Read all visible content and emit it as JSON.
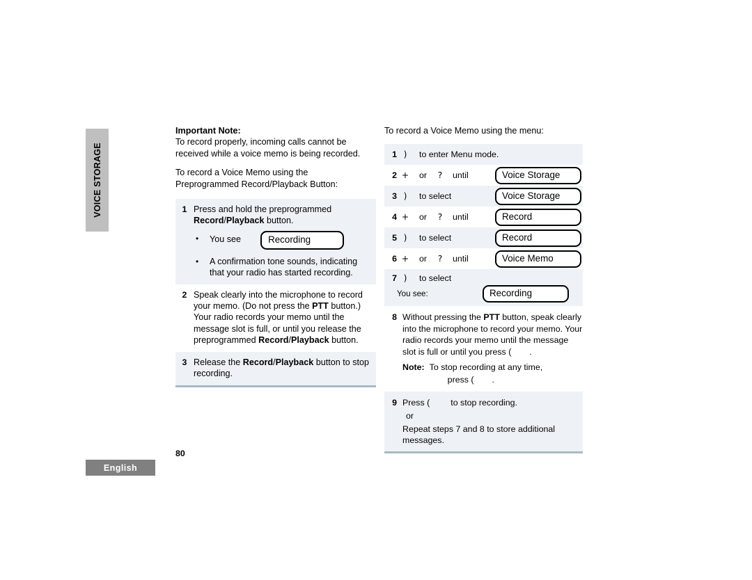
{
  "side_tab": {
    "label": "VOICE STORAGE"
  },
  "footer": {
    "language": "English",
    "page_number": "80"
  },
  "left_column": {
    "important_note_heading": "Important Note:",
    "important_note_body": "To record properly, incoming calls cannot be received while a voice memo is being recorded.",
    "intro_line1": "To record a Voice Memo using the",
    "intro_line2_prefix": "Preprogrammed Record/Playback Button",
    "intro_line2_suffix": ":",
    "steps": [
      {
        "number": "1",
        "text_parts": [
          "Press and hold the preprogrammed ",
          "Record",
          "/",
          "Playback",
          " button."
        ],
        "bullets": [
          {
            "label": "You see",
            "lcd": "Recording"
          },
          {
            "label": "A confirmation tone sounds, indicating that your radio has started recording."
          }
        ]
      },
      {
        "number": "2",
        "text_parts": [
          "Speak clearly into the microphone to record your memo. (Do not press the ",
          "PTT",
          " button.) Your radio records your memo until the message slot is full, or until you release the preprogrammed ",
          "Record",
          "/",
          "Playback",
          " button."
        ]
      },
      {
        "number": "3",
        "text_parts": [
          "Release the ",
          "Record",
          "/",
          "Playback",
          " button to stop recording."
        ]
      }
    ]
  },
  "right_column": {
    "intro": "To record a Voice Memo using the menu:",
    "menu_steps": [
      {
        "number": "1",
        "key": ")",
        "action": "to enter Menu mode.",
        "lcd": ""
      },
      {
        "number": "2",
        "key": "+",
        "or": "or",
        "key2": "?",
        "action": "until",
        "lcd": "Voice Storage"
      },
      {
        "number": "3",
        "key": ")",
        "action": "to select",
        "lcd": "Voice Storage"
      },
      {
        "number": "4",
        "key": "+",
        "or": "or",
        "key2": "?",
        "action": "until",
        "lcd": "Record"
      },
      {
        "number": "5",
        "key": ")",
        "action": "to select",
        "lcd": "Record"
      },
      {
        "number": "6",
        "key": "+",
        "or": "or",
        "key2": "?",
        "action": "until",
        "lcd": "Voice Memo"
      }
    ],
    "step7": {
      "number": "7",
      "key": ")",
      "action": "to select",
      "you_see_label": "You see:",
      "lcd": "Recording"
    },
    "step8": {
      "number": "8",
      "text_parts": [
        "Without pressing the ",
        "PTT",
        " button, speak clearly into the microphone to record your memo. Your radio records your memo until the message slot is full or until you press ("
      ],
      "text_tail": ".",
      "note_label": "Note:",
      "note_text": "To stop recording at any time,",
      "note_text_line2": "press (",
      "note_text_line2_tail": "."
    },
    "step9": {
      "number": "9",
      "line1_prefix": "Press (",
      "line1_suffix": "to stop recording.",
      "or": "or",
      "line2": "Repeat steps 7 and 8 to store additional messages."
    }
  },
  "colors": {
    "tab_gray": "#bfbfbf",
    "footer_gray": "#808080",
    "row_shade": "#eef2f6",
    "rule_blue": "#a8b9c6"
  }
}
